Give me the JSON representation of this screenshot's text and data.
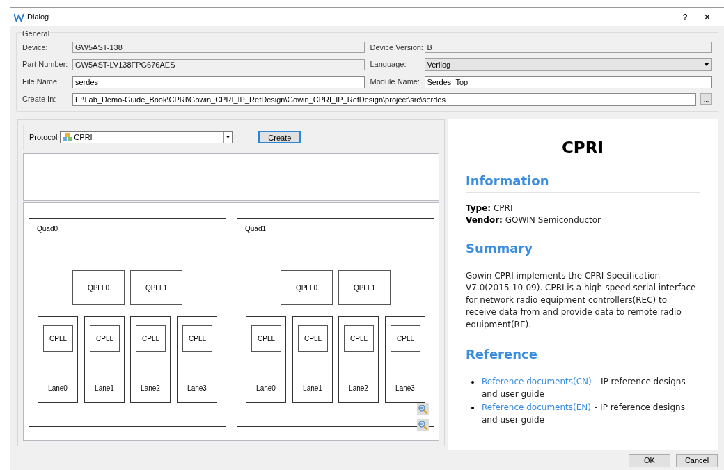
{
  "window": {
    "title": "Dialog",
    "help": "?",
    "close": "×"
  },
  "general": {
    "title": "General",
    "rows": [
      {
        "left": {
          "label": "Device:",
          "value": "GW5AST-138",
          "kind": "readonly"
        },
        "right": {
          "label": "Device Version:",
          "value": "B",
          "kind": "readonly"
        }
      },
      {
        "left": {
          "label": "Part Number:",
          "value": "GW5AST-LV138FPG676AES",
          "kind": "readonly"
        },
        "right": {
          "label": "Language:",
          "value": "Verilog",
          "kind": "select"
        }
      },
      {
        "left": {
          "label": "File Name:",
          "value": "serdes",
          "kind": "text"
        },
        "right": {
          "label": "Module Name:",
          "value": "Serdes_Top",
          "kind": "text"
        }
      }
    ],
    "create_in": {
      "label": "Create In:",
      "value": "E:\\Lab_Demo-Guide_Book\\CPRI\\Gowin_CPRI_IP_RefDesign\\Gowin_CPRI_IP_RefDesign\\project\\src\\serdes",
      "browse": "..."
    }
  },
  "protocol": {
    "label": "Protocol",
    "value": "CPRI",
    "button": "Create"
  },
  "quads": [
    {
      "name": "Quad0",
      "qplls": [
        "QPLL0",
        "QPLL1"
      ],
      "lanes": [
        {
          "name": "Lane0",
          "cpll": "CPLL"
        },
        {
          "name": "Lane1",
          "cpll": "CPLL"
        },
        {
          "name": "Lane2",
          "cpll": "CPLL"
        },
        {
          "name": "Lane3",
          "cpll": "CPLL"
        }
      ]
    },
    {
      "name": "Quad1",
      "qplls": [
        "QPLL0",
        "QPLL1"
      ],
      "lanes": [
        {
          "name": "Lane0",
          "cpll": "CPLL"
        },
        {
          "name": "Lane1",
          "cpll": "CPLL"
        },
        {
          "name": "Lane2",
          "cpll": "CPLL"
        },
        {
          "name": "Lane3",
          "cpll": "CPLL"
        }
      ]
    }
  ],
  "info": {
    "title": "CPRI",
    "sections": [
      {
        "kind": "fields",
        "heading": "Information",
        "items": [
          {
            "label": "Type:",
            "value": "CPRI"
          },
          {
            "label": "Vendor:",
            "value": "GOWIN Semiconductor"
          }
        ]
      },
      {
        "kind": "paragraph",
        "heading": "Summary",
        "text": "Gowin CPRI implements the CPRI Specification V7.0(2015-10-09). CPRI is a high-speed serial interface for network radio equipment controllers(REC) to receive data from and provide data to remote radio equipment(RE)."
      },
      {
        "kind": "links",
        "heading": "Reference",
        "items": [
          {
            "link": "Reference documents(CN)",
            "text": "- IP reference designs and user guide"
          },
          {
            "link": "Reference documents(EN)",
            "text": "- IP reference designs and user guide"
          }
        ]
      }
    ]
  },
  "buttons": [
    "OK",
    "Cancel"
  ]
}
